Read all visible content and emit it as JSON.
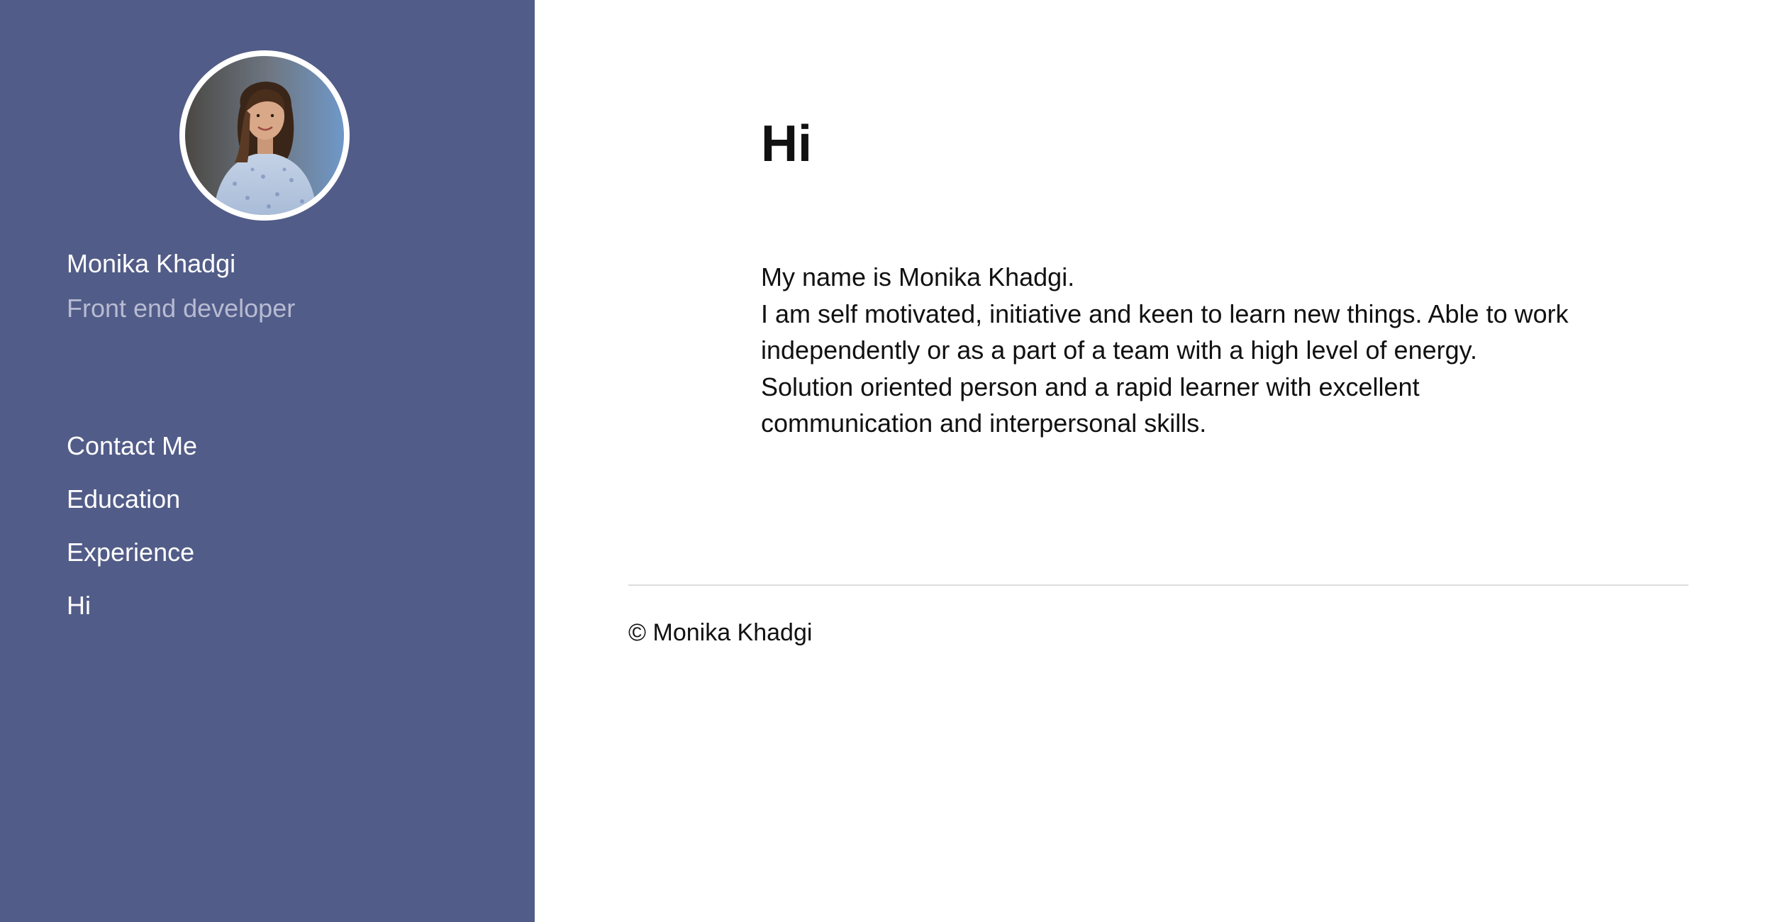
{
  "sidebar": {
    "profile": {
      "name": "Monika Khadgi",
      "role": "Front end developer"
    },
    "nav": [
      {
        "label": "Contact Me"
      },
      {
        "label": "Education"
      },
      {
        "label": "Experience"
      },
      {
        "label": "Hi"
      }
    ]
  },
  "main": {
    "title": "Hi",
    "bio_intro": "My name is Monika Khadgi.",
    "bio_body": "I am self motivated, initiative and keen to learn new things. Able to work independently or as a part of a team with a high level of energy. Solution oriented person and a rapid learner with excellent communication and interpersonal skills."
  },
  "footer": {
    "copyright": "© Monika Khadgi"
  },
  "colors": {
    "sidebar_bg": "#525c88",
    "sidebar_text": "#ffffff",
    "role_text": "#b7bbd2",
    "main_text": "#111111",
    "divider": "#dddddd"
  }
}
